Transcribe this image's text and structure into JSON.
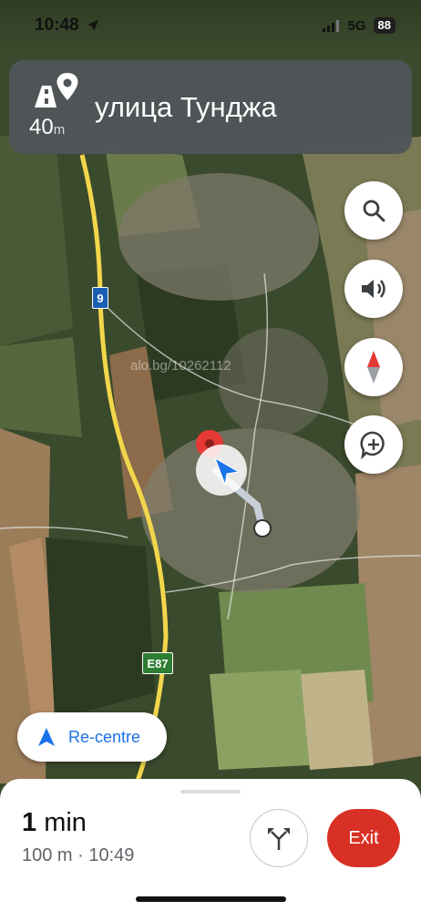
{
  "status_bar": {
    "time": "10:48",
    "network": "5G",
    "battery": "88"
  },
  "nav_banner": {
    "distance_value": "40",
    "distance_unit": "m",
    "street": "улица Тунджа",
    "icon": "turn-maneuver-icon"
  },
  "map": {
    "watermark": "alo.bg/10262112",
    "road_shields": [
      {
        "label": "9",
        "color": "#1a5fb4"
      },
      {
        "label": "E87",
        "color": "#2e7d32"
      }
    ]
  },
  "controls": {
    "search_icon": "search-icon",
    "sound_icon": "volume-icon",
    "compass_icon": "compass-icon",
    "report_icon": "add-report-icon"
  },
  "recentre": {
    "label": "Re-centre"
  },
  "trip": {
    "eta_value": "1",
    "eta_unit": "min",
    "details": "100 m · 10:49",
    "exit_label": "Exit"
  },
  "colors": {
    "accent": "#1a73e8",
    "exit": "#d93025",
    "banner": "#505458"
  }
}
